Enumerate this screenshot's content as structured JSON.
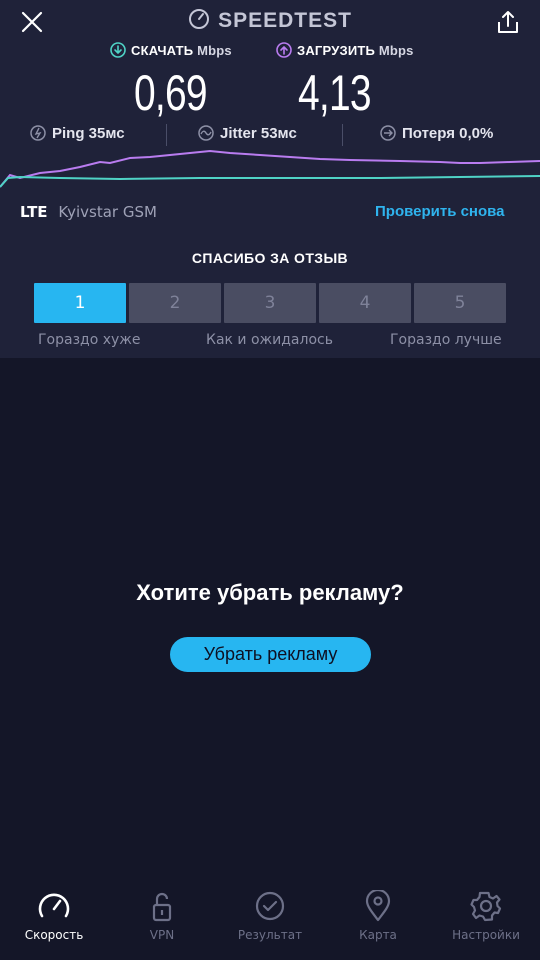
{
  "header": {
    "brand": "SPEEDTEST",
    "close_icon": "close-icon",
    "share_icon": "share-icon",
    "brand_icon": "speedometer-icon"
  },
  "download": {
    "label": "СКАЧАТЬ",
    "unit": "Mbps",
    "value": "0,69",
    "color": "#4fd3c6"
  },
  "upload": {
    "label": "ЗАГРУЗИТЬ",
    "unit": "Mbps",
    "value": "4,13",
    "color": "#b97cf0"
  },
  "stats": {
    "ping": {
      "label": "Ping",
      "value": "35мс"
    },
    "jitter": {
      "label": "Jitter",
      "value": "53мс"
    },
    "loss": {
      "label": "Потеря",
      "value": "0,0%"
    }
  },
  "network": {
    "type": "LTE",
    "operator": "Kyivstar GSM",
    "retry": "Проверить снова"
  },
  "feedback": {
    "title": "СПАСИБО ЗА ОТЗЫВ",
    "ratings": [
      "1",
      "2",
      "3",
      "4",
      "5"
    ],
    "selected": "1",
    "scale": {
      "low": "Гораздо хуже",
      "mid": "Как и ожидалось",
      "high": "Гораздо лучше"
    }
  },
  "ads": {
    "question": "Хотите убрать рекламу?",
    "button": "Убрать рекламу"
  },
  "tabs": [
    {
      "label": "Скорость",
      "icon": "gauge-icon",
      "active": true
    },
    {
      "label": "VPN",
      "icon": "unlock-icon",
      "active": false
    },
    {
      "label": "Результат",
      "icon": "check-circle-icon",
      "active": false
    },
    {
      "label": "Карта",
      "icon": "map-pin-icon",
      "active": false
    },
    {
      "label": "Настройки",
      "icon": "gear-icon",
      "active": false
    }
  ],
  "colors": {
    "accent": "#27b6f1",
    "background": "#141628",
    "panel": "#1f2239"
  }
}
